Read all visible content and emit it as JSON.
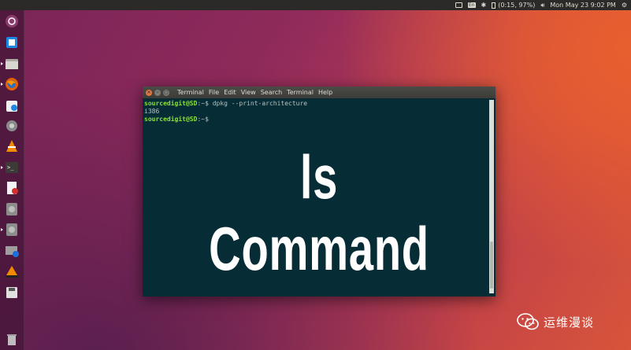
{
  "panel": {
    "battery": "(0:15, 97%)",
    "datetime": "Mon May 23  9:02 PM",
    "keyboard_layout": "En",
    "icons": [
      "screen-icon",
      "keyboard-icon",
      "bluetooth-icon",
      "battery-icon",
      "volume-icon",
      "gear-icon"
    ]
  },
  "launcher": {
    "items": [
      {
        "name": "ubuntu-dash-icon"
      },
      {
        "name": "files-icon"
      },
      {
        "name": "folder-icon"
      },
      {
        "name": "firefox-icon"
      },
      {
        "name": "software-center-icon"
      },
      {
        "name": "settings-icon"
      },
      {
        "name": "vlc-icon"
      },
      {
        "name": "terminal-icon"
      },
      {
        "name": "text-editor-icon"
      },
      {
        "name": "disk-icon"
      },
      {
        "name": "disk2-icon"
      },
      {
        "name": "screenshot-icon"
      },
      {
        "name": "vlc2-icon"
      },
      {
        "name": "save-icon"
      },
      {
        "name": "trash-icon"
      }
    ]
  },
  "terminal": {
    "title": "Terminal",
    "menu": [
      "File",
      "Edit",
      "View",
      "Search",
      "Terminal",
      "Help"
    ],
    "lines": [
      {
        "user": "sourcedigit@SD",
        "path": ":~$",
        "command": " dpkg --print-architecture"
      },
      {
        "output": "i386"
      },
      {
        "user": "sourcedigit@SD",
        "path": ":~$",
        "command": ""
      }
    ],
    "overlay_text": "ls Command"
  },
  "watermark": {
    "text": "运维漫谈"
  },
  "colors": {
    "terminal_bg": "#062c36",
    "prompt_green": "#8ae234",
    "close_button": "#e3753f",
    "panel_bg": "#2b2a28"
  }
}
